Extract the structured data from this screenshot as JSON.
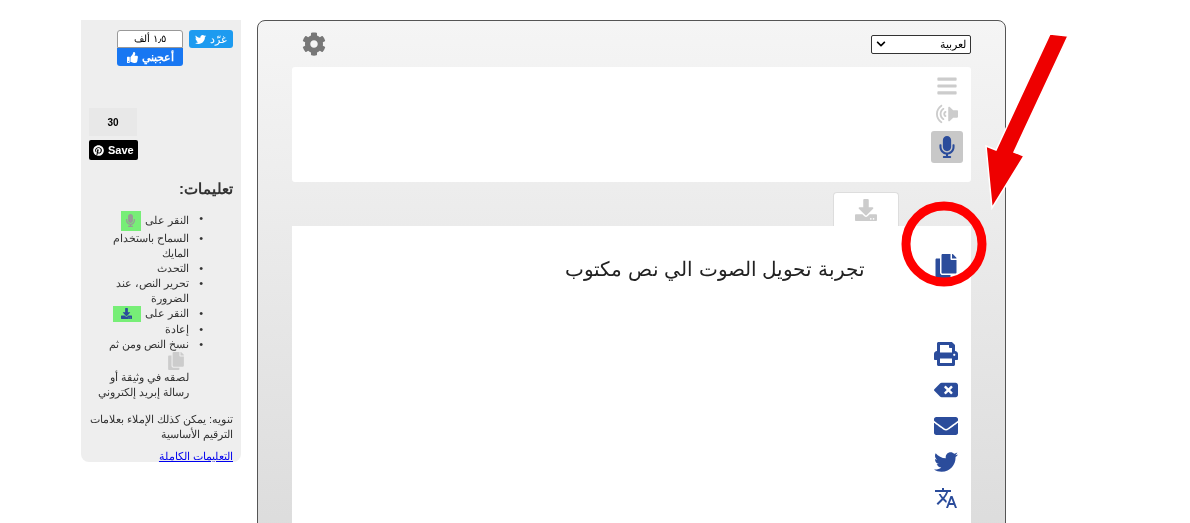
{
  "sidebar": {
    "tweet_button": "غرّد",
    "like_count": "١٫٥ ألف",
    "like_button": "أعجبني",
    "share_count": "30",
    "save_button": "Save",
    "heading": "تعليمات:",
    "steps": [
      {
        "kind": "mic",
        "marker": "•",
        "before": "النقر على"
      },
      {
        "kind": "text",
        "marker": "•",
        "before": "السماح باستخدام المايك"
      },
      {
        "kind": "text",
        "marker": "•",
        "before": "التحدث"
      },
      {
        "kind": "text",
        "marker": "•",
        "before": "تحرير النص، عند الضرورة"
      },
      {
        "kind": "download",
        "marker": "•",
        "before": "النقر على"
      },
      {
        "kind": "text",
        "marker": "•",
        "before": "إعادة"
      },
      {
        "kind": "copy",
        "marker": "•",
        "before": "نسخ النص ومن ثم",
        "after": "لصقه في وثيقة أو رسالة إبريد إلكتروني"
      }
    ],
    "note": "تنويه: يمكن كذلك الإملاء بعلامات الترقيم الأساسية",
    "link": "التعليمات الكاملة"
  },
  "main": {
    "language": "لعربية",
    "output_text": "تجربة تحويل الصوت الي نص مكتوب",
    "mic_active": true
  }
}
